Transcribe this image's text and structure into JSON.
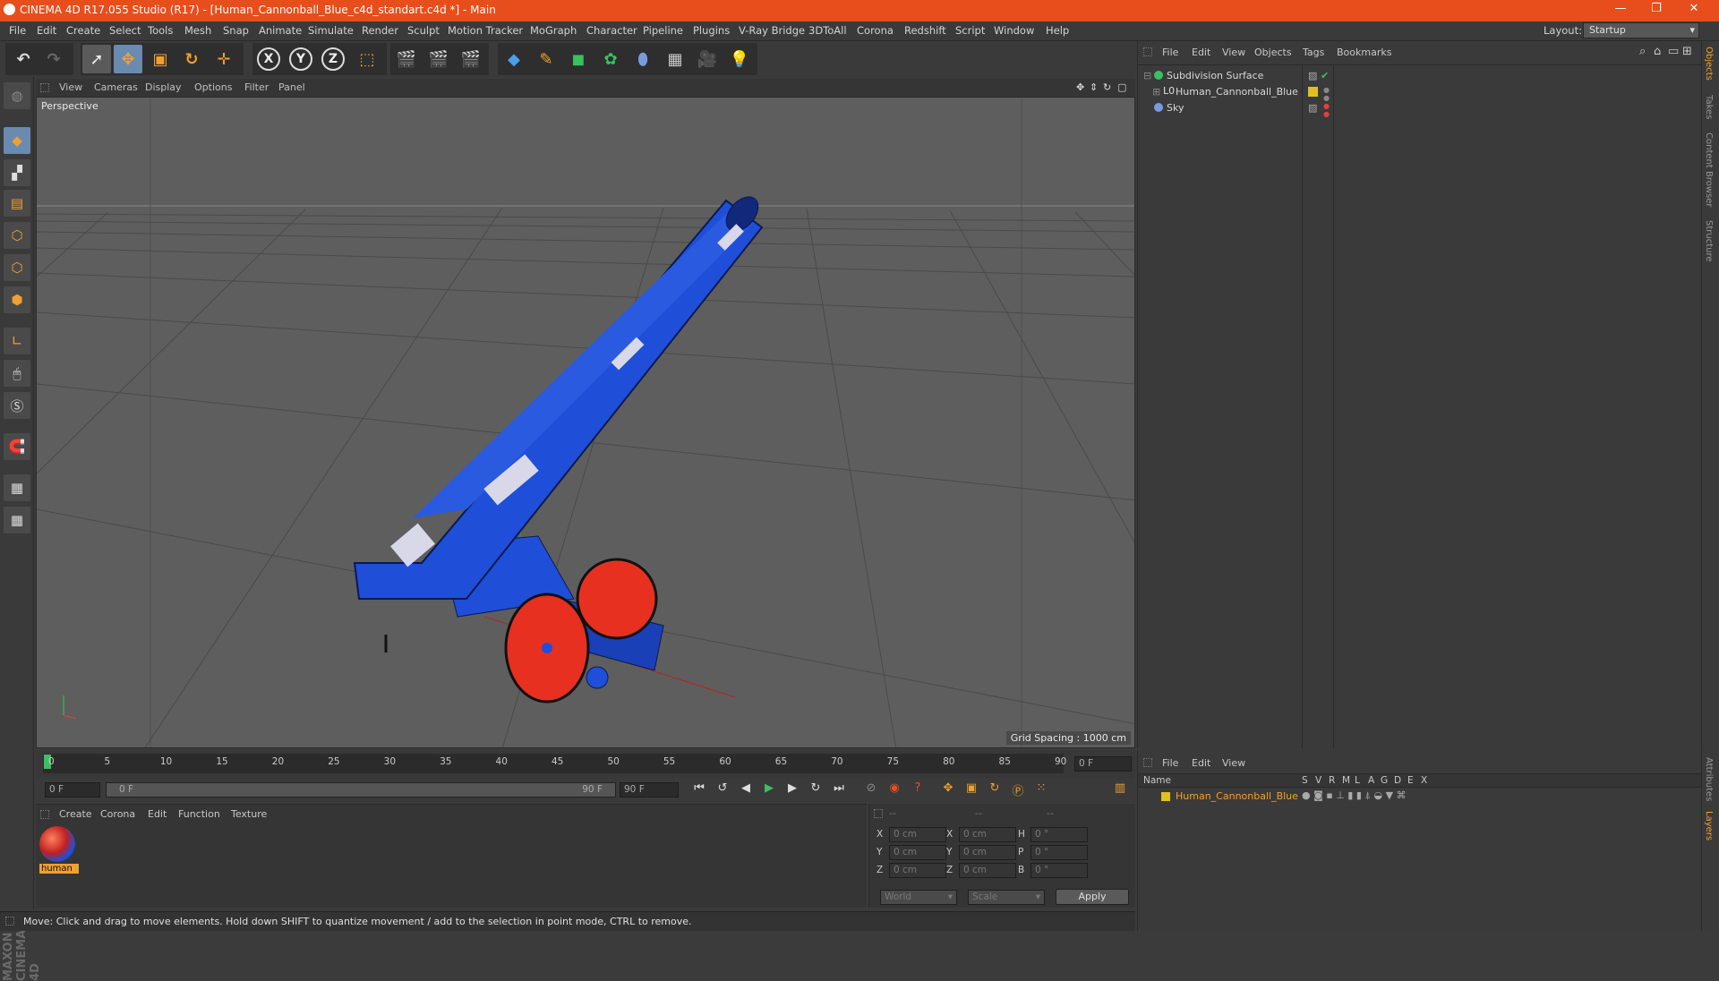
{
  "window": {
    "title": "CINEMA 4D R17.055 Studio (R17) - [Human_Cannonball_Blue_c4d_standart.c4d *] - Main",
    "controls": [
      "—",
      "❐",
      "✕"
    ]
  },
  "menu": [
    "File",
    "Edit",
    "Create",
    "Select",
    "Tools",
    "Mesh",
    "Snap",
    "Animate",
    "Simulate",
    "Render",
    "Sculpt",
    "Motion Tracker",
    "MoGraph",
    "Character",
    "Pipeline",
    "Plugins",
    "V-Ray Bridge",
    "3DToAll",
    "Corona",
    "Redshift",
    "Script",
    "Window",
    "Help"
  ],
  "layout": {
    "label": "Layout:",
    "value": "Startup"
  },
  "toolbar": {
    "axis": [
      "X",
      "Y",
      "Z"
    ]
  },
  "viewport": {
    "menu": [
      "View",
      "Cameras",
      "Display",
      "Options",
      "Filter",
      "Panel"
    ],
    "label": "Perspective",
    "grid_spacing": "Grid Spacing : 1000 cm"
  },
  "timeline": {
    "ticks": [
      "0",
      "5",
      "10",
      "15",
      "20",
      "25",
      "30",
      "35",
      "40",
      "45",
      "50",
      "55",
      "60",
      "65",
      "70",
      "75",
      "80",
      "85",
      "90"
    ],
    "current": "0 F",
    "start": "0 F",
    "range_start": "0 F",
    "range_end": "90 F",
    "end": "90 F"
  },
  "material_manager": {
    "menu": [
      "Create",
      "Corona",
      "Edit",
      "Function",
      "Texture"
    ],
    "material_name": "human"
  },
  "attributes": {
    "header": [
      "--",
      "--",
      "--"
    ],
    "rows": [
      {
        "a": "X",
        "av": "0 cm",
        "b": "X",
        "bv": "0 cm",
        "c": "H",
        "cv": "0 °"
      },
      {
        "a": "Y",
        "av": "0 cm",
        "b": "Y",
        "bv": "0 cm",
        "c": "P",
        "cv": "0 °"
      },
      {
        "a": "Z",
        "av": "0 cm",
        "b": "Z",
        "bv": "0 cm",
        "c": "B",
        "cv": "0 °"
      }
    ],
    "coord_mode": "World",
    "size_mode": "Scale",
    "apply": "Apply"
  },
  "object_manager": {
    "menu": [
      "File",
      "Edit",
      "View",
      "Objects",
      "Tags",
      "Bookmarks"
    ],
    "objects": [
      {
        "name": "Subdivision Surface"
      },
      {
        "name": "Human_Cannonball_Blue"
      },
      {
        "name": "Sky"
      }
    ]
  },
  "layer_manager": {
    "menu": [
      "File",
      "Edit",
      "View"
    ],
    "columns": [
      "Name",
      "S",
      "V",
      "R",
      "M",
      "L",
      "A",
      "G",
      "D",
      "E",
      "X"
    ],
    "layers": [
      {
        "name": "Human_Cannonball_Blue",
        "color": "#e0c020"
      }
    ]
  },
  "right_tabs": [
    "Objects",
    "Takes",
    "Content Browser",
    "Structure",
    "Attributes",
    "Layers"
  ],
  "status": "Move: Click and drag to move elements. Hold down SHIFT to quantize movement / add to the selection in point mode, CTRL to remove.",
  "colors": {
    "title_bar": "#e84e1b",
    "accent": "#f0a030",
    "cannon_body": "#1f4fd8",
    "wheel": "#e83020"
  }
}
